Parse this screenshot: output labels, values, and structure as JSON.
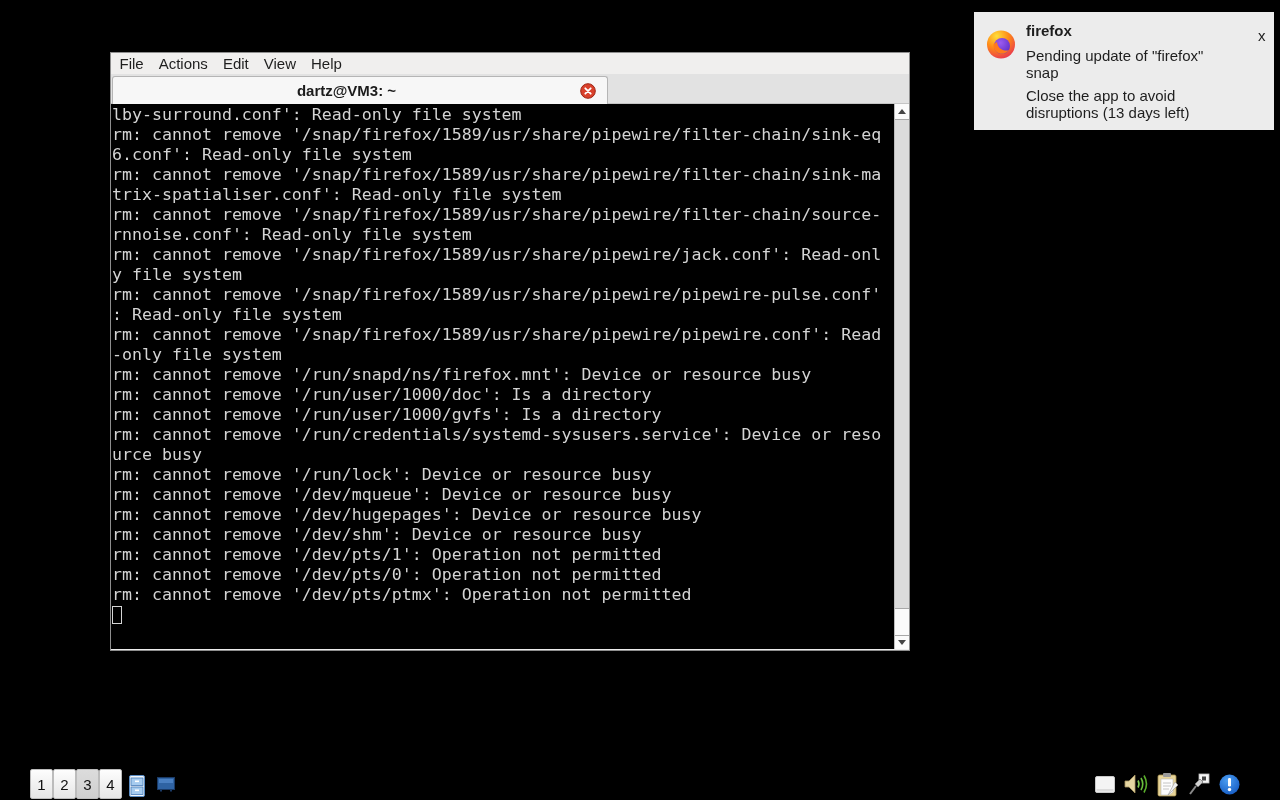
{
  "terminal_window": {
    "menu": [
      "File",
      "Actions",
      "Edit",
      "View",
      "Help"
    ],
    "tabs": [
      {
        "title": "dartz@VM3: ~",
        "selected": true
      }
    ],
    "output": [
      "lby-surround.conf': Read-only file system",
      "rm: cannot remove '/snap/firefox/1589/usr/share/pipewire/filter-chain/sink-eq6.conf': Read-only file system",
      "rm: cannot remove '/snap/firefox/1589/usr/share/pipewire/filter-chain/sink-matrix-spatialiser.conf': Read-only file system",
      "rm: cannot remove '/snap/firefox/1589/usr/share/pipewire/filter-chain/source-rnnoise.conf': Read-only file system",
      "rm: cannot remove '/snap/firefox/1589/usr/share/pipewire/jack.conf': Read-only file system",
      "rm: cannot remove '/snap/firefox/1589/usr/share/pipewire/pipewire-pulse.conf': Read-only file system",
      "rm: cannot remove '/snap/firefox/1589/usr/share/pipewire/pipewire.conf': Read-only file system",
      "rm: cannot remove '/run/snapd/ns/firefox.mnt': Device or resource busy",
      "rm: cannot remove '/run/user/1000/doc': Is a directory",
      "rm: cannot remove '/run/user/1000/gvfs': Is a directory",
      "rm: cannot remove '/run/credentials/systemd-sysusers.service': Device or resource busy",
      "rm: cannot remove '/run/lock': Device or resource busy",
      "rm: cannot remove '/dev/mqueue': Device or resource busy",
      "rm: cannot remove '/dev/hugepages': Device or resource busy",
      "rm: cannot remove '/dev/shm': Device or resource busy",
      "rm: cannot remove '/dev/pts/1': Operation not permitted",
      "rm: cannot remove '/dev/pts/0': Operation not permitted",
      "rm: cannot remove '/dev/pts/ptmx': Operation not permitted"
    ]
  },
  "notification": {
    "title": "firefox",
    "messages": [
      "Pending update of \"firefox\" snap",
      "Close the app to avoid disruptions (13 days left)"
    ],
    "close": "x"
  },
  "taskbar": {
    "workspaces": [
      {
        "label": "1",
        "selected": false
      },
      {
        "label": "2",
        "selected": false
      },
      {
        "label": "3",
        "selected": true
      },
      {
        "label": "4",
        "selected": false
      }
    ]
  }
}
